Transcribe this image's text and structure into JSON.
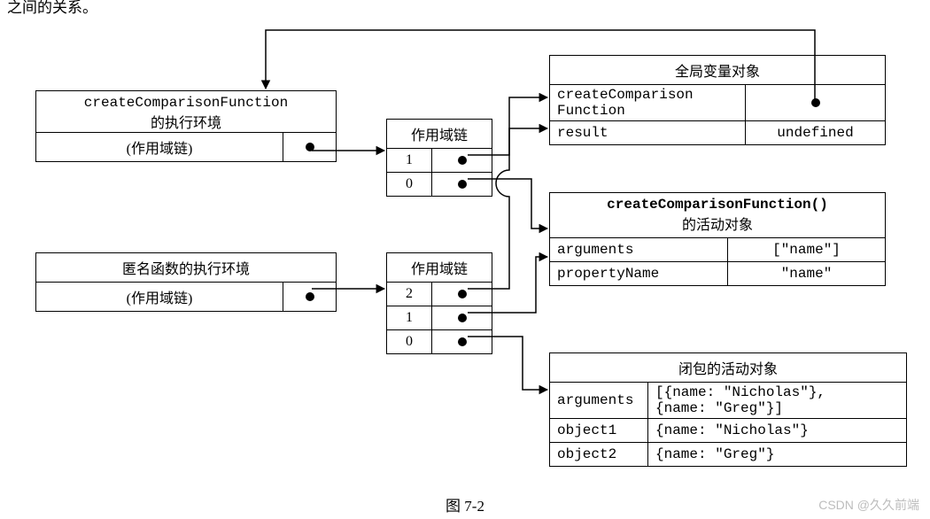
{
  "fragment_text": "之间的关系。",
  "env1": {
    "title1": "createComparisonFunction",
    "title2": "的执行环境",
    "scope_label": "(作用域链)"
  },
  "env2": {
    "title": "匿名函数的执行环境",
    "scope_label": "(作用域链)"
  },
  "scopechain1": {
    "header": "作用域链",
    "rows": [
      "1",
      "0"
    ]
  },
  "scopechain2": {
    "header": "作用域链",
    "rows": [
      "2",
      "1",
      "0"
    ]
  },
  "global": {
    "title": "全局变量对象",
    "rows": [
      {
        "k1": "createComparison",
        "k2": "Function",
        "v": ""
      },
      {
        "k": "result",
        "v": "undefined"
      }
    ]
  },
  "activation1": {
    "title1": "createComparisonFunction()",
    "title2": "的活动对象",
    "rows": [
      {
        "k": "arguments",
        "v": "[\"name\"]"
      },
      {
        "k": "propertyName",
        "v": "\"name\""
      }
    ]
  },
  "closure": {
    "title": "闭包的活动对象",
    "rows": [
      {
        "k": "arguments",
        "v1": "[{name: \"Nicholas\"},",
        "v2": " {name: \"Greg\"}]"
      },
      {
        "k": "object1",
        "v": "{name: \"Nicholas\"}"
      },
      {
        "k": "object2",
        "v": "{name: \"Greg\"}"
      }
    ]
  },
  "fig_caption": "图  7-2",
  "watermark": "CSDN @久久前端"
}
